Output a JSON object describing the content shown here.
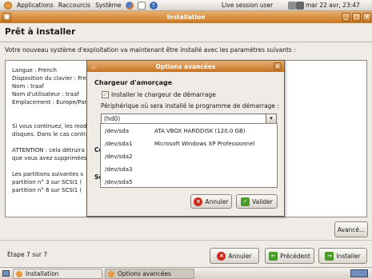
{
  "panel": {
    "menus": [
      "Applications",
      "Raccourcis",
      "Système"
    ],
    "status_text": "Live session user",
    "datetime": "mar 22 avr, 23:47"
  },
  "window": {
    "title": "Installation"
  },
  "page": {
    "heading": "Prêt à installer",
    "intro": "Votre nouveau système d'exploitation va maintenant être installé avec les paramètres suivants :",
    "summary": [
      "Langue : French",
      "Disposition du clavier : French",
      "Nom : traaf",
      "Nom d'utilisateur : traaf",
      "Emplacement : Europe/Paris",
      "",
      "Si vous continuez, les modifications suivantes seront écrites sur les",
      "disques. Dans le cas contraire,",
      "",
      "ATTENTION : cela détruira",
      "que vous avez supprimées",
      "",
      "Les partitions suivantes s",
      "partition n° 3 sur SCSI1 (",
      "partition n° 6 sur SCSI1 ("
    ],
    "advanced_button": "Avancé...",
    "step": "Étape 7 sur 7",
    "buttons": {
      "cancel": "Annuler",
      "back": "Précédent",
      "install": "Installer"
    }
  },
  "dialog": {
    "title": "Options avancées",
    "section": "Chargeur d'amorçage",
    "checkbox_label": "Installer le chargeur de démarrage",
    "checkbox_checked": true,
    "device_label": "Périphérique où sera installé le programme de démarrage :",
    "selected_device": "(hd0)",
    "partial_labels": [
      "Co",
      "Se"
    ],
    "devices": [
      {
        "dev": "/dev/sda",
        "desc": "ATA VBOX HARDDISK (120.0 GB)"
      },
      {
        "dev": "/dev/sda1",
        "desc": "Microsoft Windows XP Professionnel"
      },
      {
        "dev": "/dev/sda2",
        "desc": ""
      },
      {
        "dev": "/dev/sda3",
        "desc": ""
      },
      {
        "dev": "/dev/sda5",
        "desc": ""
      }
    ],
    "buttons": {
      "cancel": "Annuler",
      "ok": "Valider"
    }
  },
  "taskbar": {
    "tasks": [
      "Installation",
      "Options avancées"
    ]
  },
  "colors": {
    "title_bar": "#c8761f",
    "accent": "#e9b171"
  }
}
